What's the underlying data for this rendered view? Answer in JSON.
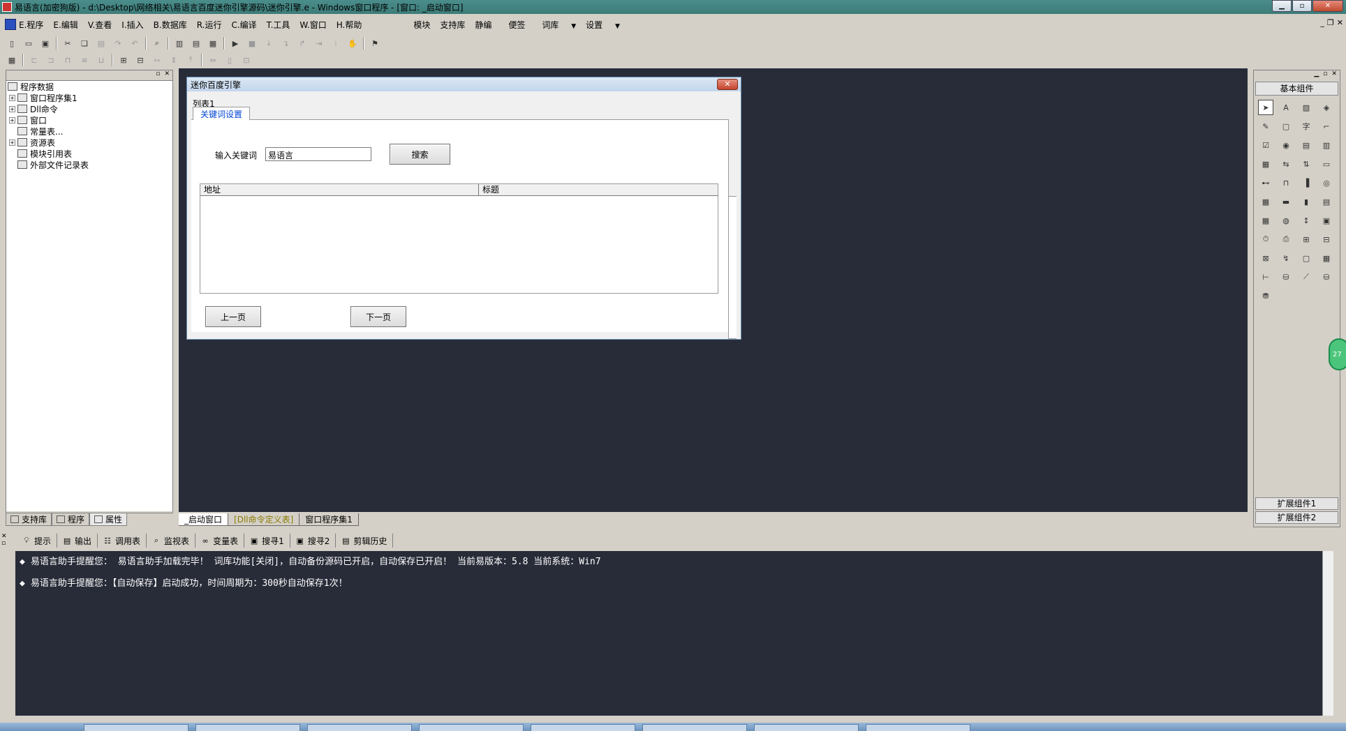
{
  "window": {
    "title": "易语言(加密狗版) - d:\\Desktop\\网络相关\\易语言百度迷你引擎源码\\迷你引擎.e - Windows窗口程序 - [窗口: _启动窗口]"
  },
  "menu": {
    "items": [
      "E.程序",
      "E.编辑",
      "V.查看",
      "I.插入",
      "B.数据库",
      "R.运行",
      "C.编译",
      "T.工具",
      "W.窗口",
      "H.帮助"
    ],
    "extra": [
      "模块",
      "支持库",
      "静编",
      "便签",
      "词库",
      "设置"
    ]
  },
  "tree": {
    "root": "程序数据",
    "items": [
      {
        "label": "窗口程序集1",
        "expander": "+"
      },
      {
        "label": "Dll命令",
        "expander": "+"
      },
      {
        "label": "窗口",
        "expander": "+"
      },
      {
        "label": "常量表...",
        "expander": ""
      },
      {
        "label": "资源表",
        "expander": "+"
      },
      {
        "label": "模块引用表",
        "expander": ""
      },
      {
        "label": "外部文件记录表",
        "expander": ""
      }
    ]
  },
  "left_tabs": [
    "支持库",
    "程序",
    "属性"
  ],
  "form": {
    "caption": "迷你百度引擎",
    "close_glyph": "✕",
    "list_label": "列表1",
    "tab_label": "关键词设置",
    "keyword_label": "输入关键词",
    "keyword_value": "易语言",
    "search_button": "搜索",
    "columns": [
      "地址",
      "标题"
    ],
    "prev_button": "上一页",
    "next_button": "下一页"
  },
  "doc_tabs": [
    "_启动窗口",
    "[Dll命令定义表]",
    "窗口程序集1"
  ],
  "palette": {
    "header": "基本组件",
    "footer1": "扩展组件1",
    "footer2": "扩展组件2"
  },
  "output_tabs": [
    "提示",
    "输出",
    "调用表",
    "监视表",
    "变量表",
    "搜寻1",
    "搜寻2",
    "剪辑历史"
  ],
  "output_lines": [
    "易语言助手提醒您：  易语言助手加载完毕！  词库功能[关闭]，自动备份源码已开启，自动保存已开启！  当前易版本：5.8  当前系统：Win7",
    "易语言助手提醒您：【自动保存】启动成功，时间周期为：300秒自动保存1次！"
  ],
  "badge_text": "27",
  "colors": {
    "titlebar": "#4a8d8a",
    "canvas": "#282c38",
    "tab_link": "#0046d5"
  }
}
